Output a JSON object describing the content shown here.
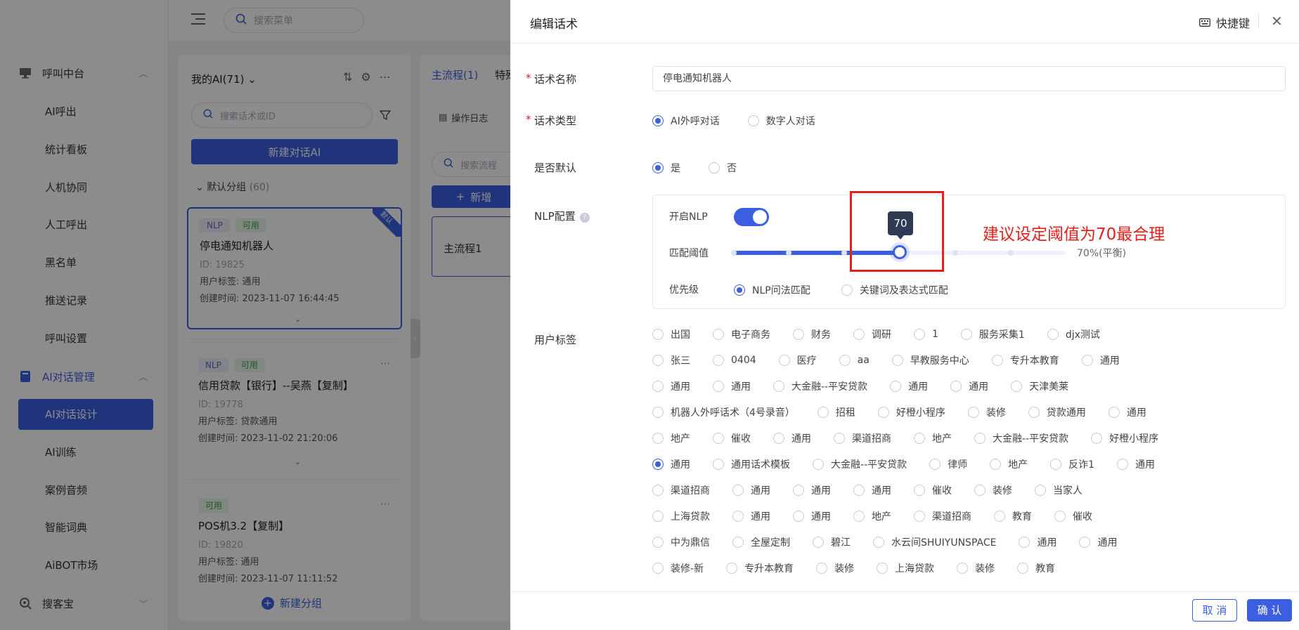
{
  "sidebar": {
    "groups": [
      {
        "label": "呼叫中台",
        "icon": "monitor-icon"
      },
      {
        "label": "AI对话管理",
        "icon": "book-icon"
      },
      {
        "label": "搜客宝",
        "icon": "search-plus-icon"
      }
    ],
    "call_items": [
      "AI呼出",
      "统计看板",
      "人机协同",
      "人工呼出",
      "黑名单",
      "推送记录",
      "呼叫设置"
    ],
    "ai_items": [
      "AI对话设计",
      "AI训练",
      "案例音频",
      "智能词典",
      "AiBOT市场"
    ]
  },
  "topbar": {
    "search_placeholder": "搜索菜单"
  },
  "list": {
    "title": "我的AI(71)",
    "search_placeholder": "搜索话术或ID",
    "new_button": "新建对话AI",
    "group_name": "默认分组",
    "group_count": "(60)",
    "default_badge": "默认",
    "new_group": "新建分组",
    "cards": [
      {
        "tags": [
          "NLP",
          "可用"
        ],
        "name": "停电通知机器人",
        "id": "ID: 19825",
        "user_tag": "用户标签: 通用",
        "created": "创建时间: 2023-11-07 16:44:45"
      },
      {
        "tags": [
          "NLP",
          "可用"
        ],
        "name": "信用贷款【银行】--吴燕【复制】",
        "id": "ID: 19778",
        "user_tag": "用户标签: 贷款通用",
        "created": "创建时间: 2023-11-02 21:20:06"
      },
      {
        "tags": [
          "可用"
        ],
        "name": "POS机3.2【复制】",
        "id": "ID: 19820",
        "user_tag": "用户标签: 通用",
        "created": "创建时间: 2023-11-07 11:11:52"
      }
    ]
  },
  "flow": {
    "tab_main": "主流程(1)",
    "tab_other": "特殊",
    "oplog": "操作日志",
    "search_placeholder": "搜索流程",
    "add_button": "新增",
    "card": "主流程1"
  },
  "drawer": {
    "title": "编辑话术",
    "shortcut": "快捷键",
    "name_label": "话术名称",
    "name_value": "停电通知机器人",
    "type_label": "话术类型",
    "type_options": [
      {
        "label": "AI外呼对话",
        "on": true
      },
      {
        "label": "数字人对话",
        "on": false
      }
    ],
    "default_label": "是否默认",
    "default_options": [
      {
        "label": "是",
        "on": true
      },
      {
        "label": "否",
        "on": false
      }
    ],
    "nlp_label": "NLP配置",
    "nlp_enable_label": "开启NLP",
    "nlp_enabled": true,
    "threshold_label": "匹配阈值",
    "threshold": 70,
    "threshold_tip": "70",
    "threshold_text": "70%(平衡)",
    "priority_label": "优先级",
    "priority_options": [
      {
        "label": "NLP问法匹配",
        "on": true
      },
      {
        "label": "关键词及表达式匹配",
        "on": false
      }
    ],
    "annotation": "建议设定阈值为70最合理",
    "user_tag_label": "用户标签",
    "user_tag_rows": [
      [
        "出国",
        "电子商务",
        "财务",
        "调研",
        "1",
        "服务采集1",
        "djx测试"
      ],
      [
        "张三",
        "0404",
        "医疗",
        "aa",
        "早教服务中心",
        "专升本教育",
        "通用"
      ],
      [
        "通用",
        "通用",
        "大金融--平安贷款",
        "通用",
        "通用",
        "天津美莱"
      ],
      [
        "机器人外呼话术（4号录音）",
        "招租",
        "好橙小程序",
        "装修",
        "贷款通用",
        "通用"
      ],
      [
        "地产",
        "催收",
        "通用",
        "渠道招商",
        "地产",
        "大金融--平安贷款",
        "好橙小程序"
      ],
      [
        "通用",
        "通用话术模板",
        "大金融--平安贷款",
        "律师",
        "地产",
        "反诈1",
        "通用"
      ],
      [
        "渠道招商",
        "通用",
        "通用",
        "通用",
        "催收",
        "装修",
        "当家人"
      ],
      [
        "上海贷款",
        "通用",
        "通用",
        "地产",
        "渠道招商",
        "教育",
        "催收"
      ],
      [
        "中为鼎信",
        "全屋定制",
        "碧江",
        "水云间SHUIYUNSPACE",
        "通用",
        "通用"
      ],
      [
        "装修-新",
        "专升本教育",
        "装修",
        "上海贷款",
        "装修",
        "教育"
      ]
    ],
    "selected_tag": "5-0",
    "cancel": "取 消",
    "confirm": "确 认"
  },
  "colors": {
    "primary": "#3b5fe0",
    "annotation": "#e5201a"
  }
}
